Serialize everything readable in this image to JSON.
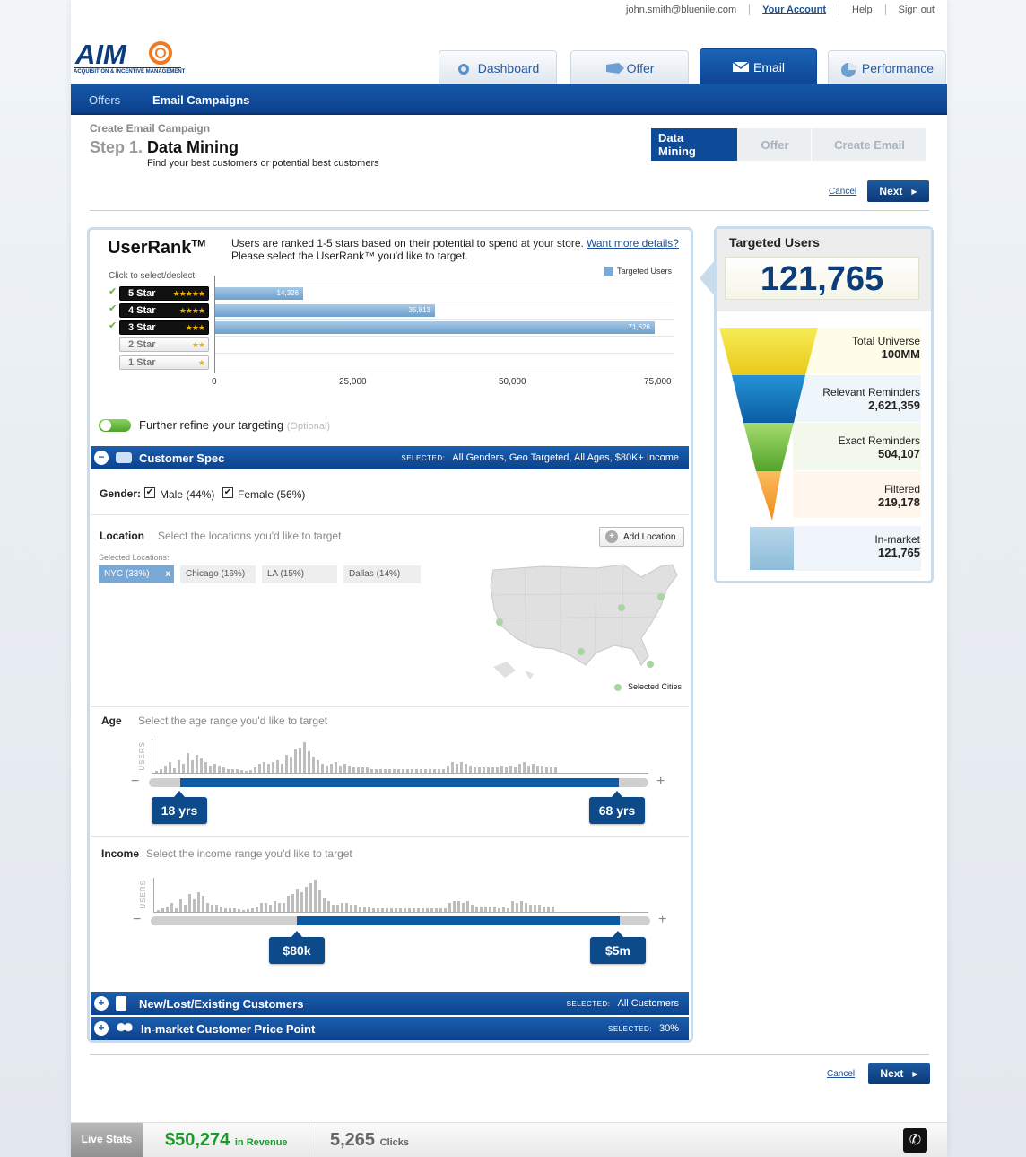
{
  "top_nav": {
    "email": "john.smith@bluenile.com",
    "account": "Your Account",
    "help": "Help",
    "signout": "Sign out"
  },
  "logo": {
    "text": "AIM",
    "subtitle": "ACQUISITION & INCENTIVE MANAGEMENT"
  },
  "tabs": [
    {
      "label": "Dashboard",
      "icon": "dashboard-icon"
    },
    {
      "label": "Offer",
      "icon": "offer-tag-icon"
    },
    {
      "label": "Email",
      "icon": "envelope-icon"
    },
    {
      "label": "Performance",
      "icon": "pie-chart-icon"
    }
  ],
  "subnav": {
    "offers": "Offers",
    "campaigns": "Email Campaigns"
  },
  "header": {
    "breadcrumb": "Create Email Campaign",
    "step": "Step 1.",
    "title": "Data Mining",
    "subtitle": "Find your best customers or potential best customers"
  },
  "wizard": [
    "Data Mining",
    "Offer",
    "Create Email"
  ],
  "actions": {
    "cancel": "Cancel",
    "next": "Next"
  },
  "userrank": {
    "title": "UserRank",
    "tm": "TM",
    "desc1": "Users are ranked 1-5 stars based on their potential to spend at your store.",
    "link": "Want more details?",
    "desc2": "Please select the UserRank™ you'd like to target.",
    "click_hint": "Click to select/deslect:",
    "legend": "Targeted Users",
    "stars": [
      {
        "label": "5 Star",
        "stars": "★★★★★",
        "selected": true,
        "value": 14326,
        "text": "14,326"
      },
      {
        "label": "4 Star",
        "stars": "★★★★",
        "selected": true,
        "value": 35813,
        "text": "35,813"
      },
      {
        "label": "3 Star",
        "stars": "★★★",
        "selected": true,
        "value": 71626,
        "text": "71,626"
      },
      {
        "label": "2 Star",
        "stars": "★★",
        "selected": false,
        "value": 0,
        "text": ""
      },
      {
        "label": "1 Star",
        "stars": "★",
        "selected": false,
        "value": 0,
        "text": ""
      }
    ],
    "axis": [
      "0",
      "25,000",
      "50,000",
      "75,000"
    ],
    "xmax": 75000
  },
  "refine": {
    "label": "Further refine your targeting",
    "optional": "(Optional)"
  },
  "customer_spec": {
    "title": "Customer Spec",
    "selected_label": "SELECTED:",
    "selected": "All Genders, Geo Targeted, All Ages, $80K+ Income",
    "gender_label": "Gender:",
    "male": "Male (44%)",
    "female": "Female (56%)",
    "location_label": "Location",
    "location_hint": "Select the locations you'd like to target",
    "add_location": "Add Location",
    "selected_locations": "Selected Locations:",
    "locations": [
      "NYC (33%)",
      "Chicago (16%)",
      "LA (15%)",
      "Dallas (14%)"
    ],
    "remove": "x",
    "map_legend": "Selected Cities",
    "age_label": "Age",
    "age_hint": "Select the age range you'd like to target",
    "age_min": "18 yrs",
    "age_max": "68 yrs",
    "income_label": "Income",
    "income_hint": "Select the income range you'd like to target",
    "income_min": "$80k",
    "income_max": "$5m",
    "users_axis": "USERS",
    "minus": "−",
    "plus": "+"
  },
  "new_lost": {
    "title": "New/Lost/Existing Customers",
    "selected_label": "SELECTED:",
    "selected": "All Customers"
  },
  "price_point": {
    "title": "In-market Customer Price Point",
    "selected_label": "SELECTED:",
    "selected": "30%"
  },
  "targeted": {
    "title": "Targeted Users",
    "value": "121,765",
    "funnel": [
      {
        "label": "Total Universe",
        "value": "100MM",
        "color": "#f2e03a"
      },
      {
        "label": "Relevant Reminders",
        "value": "2,621,359",
        "color": "#1b7fc4"
      },
      {
        "label": "Exact Reminders",
        "value": "504,107",
        "color": "#7dc242"
      },
      {
        "label": "Filtered",
        "value": "219,178",
        "color": "#f7a13a"
      },
      {
        "label": "In-market",
        "value": "121,765",
        "color": "#9cc5df"
      }
    ]
  },
  "live_stats": {
    "label": "Live Stats",
    "revenue": "$50,274",
    "revenue_unit": "in Revenue",
    "clicks": "5,265",
    "clicks_unit": "Clicks"
  },
  "colors": {
    "brand_blue": "#0d4a98",
    "accent_green": "#1a9a2c"
  }
}
